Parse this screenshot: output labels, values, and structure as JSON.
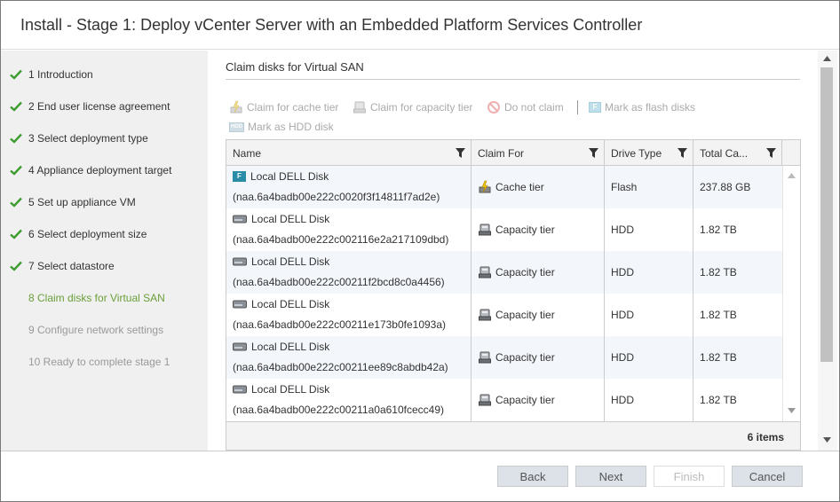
{
  "window": {
    "title": "Install - Stage 1: Deploy vCenter Server with an Embedded Platform Services Controller"
  },
  "steps": [
    {
      "label": "1 Introduction",
      "state": "done"
    },
    {
      "label": "2 End user license agreement",
      "state": "done"
    },
    {
      "label": "3 Select deployment type",
      "state": "done"
    },
    {
      "label": "4 Appliance deployment target",
      "state": "done"
    },
    {
      "label": "5 Set up appliance VM",
      "state": "done"
    },
    {
      "label": "6 Select deployment size",
      "state": "done"
    },
    {
      "label": "7 Select datastore",
      "state": "done"
    },
    {
      "label": "8 Claim disks for Virtual SAN",
      "state": "active"
    },
    {
      "label": "9 Configure network settings",
      "state": "future"
    },
    {
      "label": "10 Ready to complete stage 1",
      "state": "future"
    }
  ],
  "main": {
    "section_title": "Claim disks for Virtual SAN",
    "toolbar": {
      "claim_cache": "Claim for cache tier",
      "claim_capacity": "Claim for capacity tier",
      "do_not_claim": "Do not claim",
      "mark_flash": "Mark as flash disks",
      "mark_hdd": "Mark as HDD disk"
    },
    "grid": {
      "columns": [
        "Name",
        "Claim For",
        "Drive Type",
        "Total Ca..."
      ],
      "rows": [
        {
          "name": "Local DELL Disk",
          "id": "(naa.6a4badb00e222c0020f3f14811f7ad2e)",
          "claim": "Cache tier",
          "type": "Flash",
          "capacity": "237.88 GB",
          "disk_icon": "flash-disk-icon"
        },
        {
          "name": "Local DELL Disk",
          "id": "(naa.6a4badb00e222c002116e2a217109dbd)",
          "claim": "Capacity tier",
          "type": "HDD",
          "capacity": "1.82 TB",
          "disk_icon": "hdd-disk-icon"
        },
        {
          "name": "Local DELL Disk",
          "id": "(naa.6a4badb00e222c00211f2bcd8c0a4456)",
          "claim": "Capacity tier",
          "type": "HDD",
          "capacity": "1.82 TB",
          "disk_icon": "hdd-disk-icon"
        },
        {
          "name": "Local DELL Disk",
          "id": "(naa.6a4badb00e222c00211e173b0fe1093a)",
          "claim": "Capacity tier",
          "type": "HDD",
          "capacity": "1.82 TB",
          "disk_icon": "hdd-disk-icon"
        },
        {
          "name": "Local DELL Disk",
          "id": "(naa.6a4badb00e222c00211ee89c8abdb42a)",
          "claim": "Capacity tier",
          "type": "HDD",
          "capacity": "1.82 TB",
          "disk_icon": "hdd-disk-icon"
        },
        {
          "name": "Local DELL Disk",
          "id": "(naa.6a4badb00e222c00211a0a610fcecc49)",
          "claim": "Capacity tier",
          "type": "HDD",
          "capacity": "1.82 TB",
          "disk_icon": "hdd-disk-icon"
        }
      ],
      "item_count": "6 items"
    }
  },
  "footer": {
    "back": "Back",
    "next": "Next",
    "finish": "Finish",
    "cancel": "Cancel"
  },
  "colors": {
    "check_green": "#3c9a2e",
    "active_step": "#6a9f3a",
    "future_step": "#999999"
  }
}
